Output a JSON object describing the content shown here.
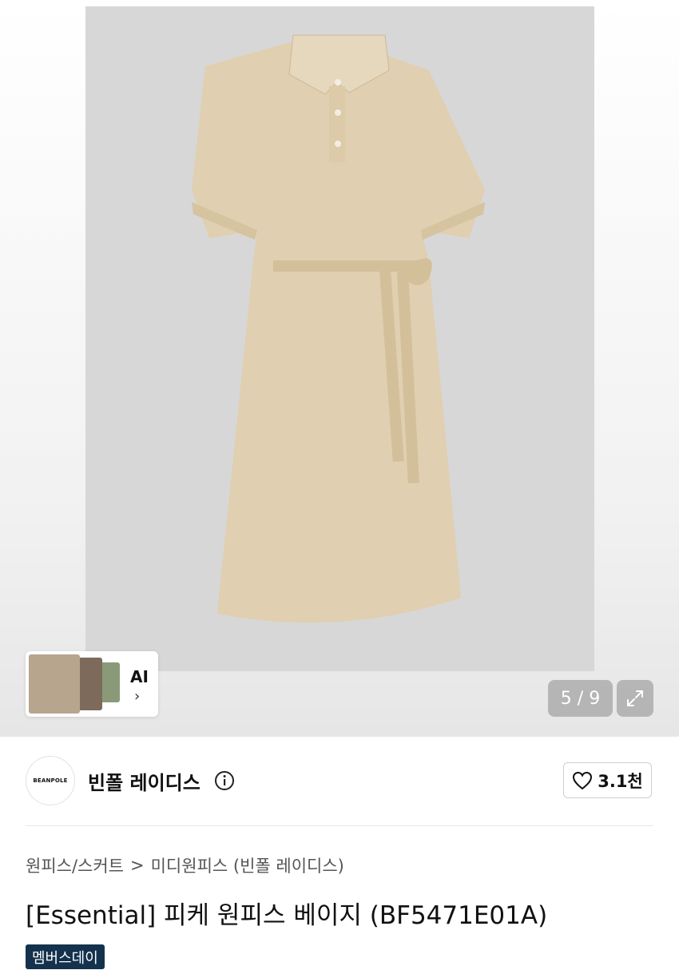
{
  "gallery": {
    "counter": "5 / 9",
    "ai_label": "AI",
    "image_bg": "#d7d7d7",
    "product_color": "#e0cfb0"
  },
  "brand": {
    "logo_text": "BEANPOLE",
    "name": "빈폴 레이디스",
    "like_count": "3.1천"
  },
  "breadcrumb": {
    "category": "원피스/스커트",
    "separator": ">",
    "subcategory": "미디원피스 (빈폴 레이디스)"
  },
  "product": {
    "title": "[Essential] 피케 원피스 베이지 (BF5471E01A)",
    "badge": "멤버스데이"
  },
  "colors": {
    "badge_bg": "#14324d",
    "accent_text": "#111111"
  },
  "icons": [
    "info-icon",
    "heart-icon",
    "expand-icon",
    "chevron-right-icon"
  ]
}
